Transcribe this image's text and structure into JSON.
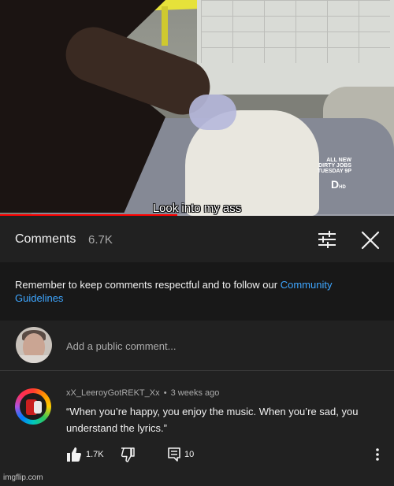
{
  "video": {
    "caption": "Look into my ass",
    "logo_text": "ALL NEW DIRTY JOBS TUESDAY 9P",
    "badge": "HD",
    "progress_fraction": 0.45,
    "progress_color": "#ff0000"
  },
  "header": {
    "title": "Comments",
    "count": "6.7K",
    "filter_icon": "sliders-icon",
    "close_icon": "close-icon"
  },
  "guidelines": {
    "text": "Remember to keep comments respectful and to follow our ",
    "link": "Community Guidelines",
    "link_color": "#3ea6ff"
  },
  "add_comment": {
    "placeholder": "Add a public comment..."
  },
  "comment": {
    "author": "xX_LeeroyGotREKT_Xx",
    "separator": "•",
    "time": "3 weeks ago",
    "text": "“When you’re happy, you enjoy the music. When you’re sad, you understand the lyrics.”",
    "likes": "1.7K",
    "replies": "10",
    "icons": [
      "thumbs-up-icon",
      "thumbs-down-icon",
      "reply-icon",
      "more-vert-icon"
    ]
  },
  "watermark": "imgflip.com"
}
